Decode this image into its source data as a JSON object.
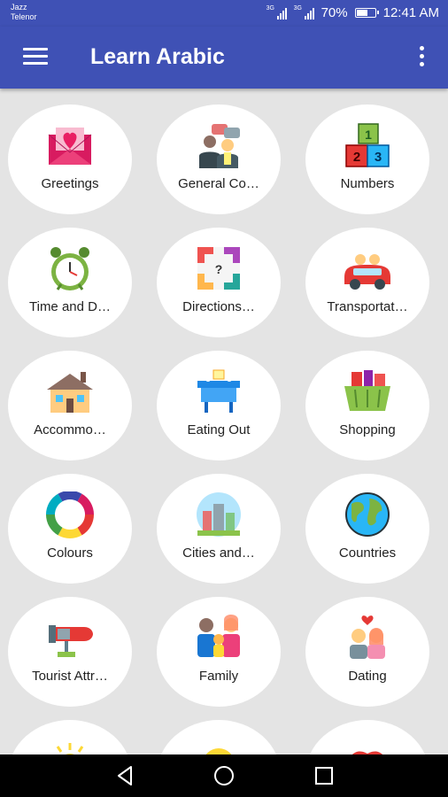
{
  "status_bar": {
    "carrier_1": "Jazz",
    "carrier_2": "Telenor",
    "sim_tag_1": "3G",
    "sim_tag_2": "3G",
    "battery": "70%",
    "time": "12:41 AM",
    "battery_level": 0.7
  },
  "app_bar": {
    "title": "Learn Arabic",
    "menu_icon": "hamburger-menu-icon",
    "overflow_icon": "more-vert-icon"
  },
  "categories": [
    {
      "label": "Greetings",
      "icon": "envelope-heart-icon"
    },
    {
      "label": "General Co…",
      "icon": "conversation-icon"
    },
    {
      "label": "Numbers",
      "icon": "number-blocks-icon"
    },
    {
      "label": "Time and D…",
      "icon": "alarm-clock-icon"
    },
    {
      "label": "Directions…",
      "icon": "directions-icon"
    },
    {
      "label": "Transportat…",
      "icon": "car-icon"
    },
    {
      "label": "Accommo…",
      "icon": "house-icon"
    },
    {
      "label": "Eating Out",
      "icon": "dining-table-icon"
    },
    {
      "label": "Shopping",
      "icon": "shopping-basket-icon"
    },
    {
      "label": "Colours",
      "icon": "color-wheel-icon"
    },
    {
      "label": "Cities and…",
      "icon": "city-icon"
    },
    {
      "label": "Countries",
      "icon": "globe-icon"
    },
    {
      "label": "Tourist Attr…",
      "icon": "rocket-icon"
    },
    {
      "label": "Family",
      "icon": "family-icon"
    },
    {
      "label": "Dating",
      "icon": "couple-icon"
    }
  ],
  "partial_row_icons": [
    "sun-icon",
    "smiley-icon",
    "lips-icon"
  ],
  "navigation": {
    "back_icon": "back-triangle-icon",
    "home_icon": "home-circle-icon",
    "recents_icon": "recents-square-icon"
  },
  "colors": {
    "primary": "#3f51b5",
    "background": "#e4e4e4",
    "tile": "#ffffff"
  }
}
